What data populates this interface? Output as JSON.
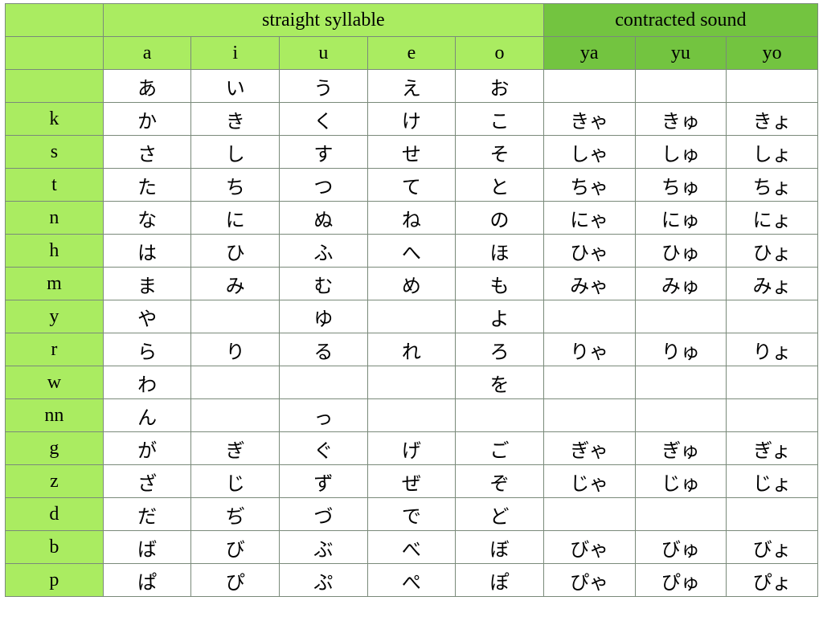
{
  "headers": {
    "straight": "straight syllable",
    "contracted": "contracted sound",
    "cols": [
      "a",
      "i",
      "u",
      "e",
      "o",
      "ya",
      "yu",
      "yo"
    ]
  },
  "rows": [
    {
      "label": "",
      "cells": [
        "あ",
        "い",
        "う",
        "え",
        "お",
        "",
        "",
        ""
      ]
    },
    {
      "label": "k",
      "cells": [
        "か",
        "き",
        "く",
        "け",
        "こ",
        "きゃ",
        "きゅ",
        "きょ"
      ]
    },
    {
      "label": "s",
      "cells": [
        "さ",
        "し",
        "す",
        "せ",
        "そ",
        "しゃ",
        "しゅ",
        "しょ"
      ]
    },
    {
      "label": "t",
      "cells": [
        "た",
        "ち",
        "つ",
        "て",
        "と",
        "ちゃ",
        "ちゅ",
        "ちょ"
      ]
    },
    {
      "label": "n",
      "cells": [
        "な",
        "に",
        "ぬ",
        "ね",
        "の",
        "にゃ",
        "にゅ",
        "にょ"
      ]
    },
    {
      "label": "h",
      "cells": [
        "は",
        "ひ",
        "ふ",
        "へ",
        "ほ",
        "ひゃ",
        "ひゅ",
        "ひょ"
      ]
    },
    {
      "label": "m",
      "cells": [
        "ま",
        "み",
        "む",
        "め",
        "も",
        "みゃ",
        "みゅ",
        "みょ"
      ]
    },
    {
      "label": "y",
      "cells": [
        "や",
        "",
        "ゆ",
        "",
        "よ",
        "",
        "",
        ""
      ]
    },
    {
      "label": "r",
      "cells": [
        "ら",
        "り",
        "る",
        "れ",
        "ろ",
        "りゃ",
        "りゅ",
        "りょ"
      ]
    },
    {
      "label": "w",
      "cells": [
        "わ",
        "",
        "",
        "",
        "を",
        "",
        "",
        ""
      ]
    },
    {
      "label": "nn",
      "cells": [
        "ん",
        "",
        "っ",
        "",
        "",
        "",
        "",
        ""
      ]
    },
    {
      "label": "g",
      "cells": [
        "が",
        "ぎ",
        "ぐ",
        "げ",
        "ご",
        "ぎゃ",
        "ぎゅ",
        "ぎょ"
      ]
    },
    {
      "label": "z",
      "cells": [
        "ざ",
        "じ",
        "ず",
        "ぜ",
        "ぞ",
        "じゃ",
        "じゅ",
        "じょ"
      ]
    },
    {
      "label": "d",
      "cells": [
        "だ",
        "ぢ",
        "づ",
        "で",
        "ど",
        "",
        "",
        ""
      ]
    },
    {
      "label": "b",
      "cells": [
        "ば",
        "び",
        "ぶ",
        "べ",
        "ぼ",
        "びゃ",
        "びゅ",
        "びょ"
      ]
    },
    {
      "label": "p",
      "cells": [
        "ぱ",
        "ぴ",
        "ぷ",
        "ぺ",
        "ぽ",
        "ぴゃ",
        "ぴゅ",
        "ぴょ"
      ]
    }
  ]
}
